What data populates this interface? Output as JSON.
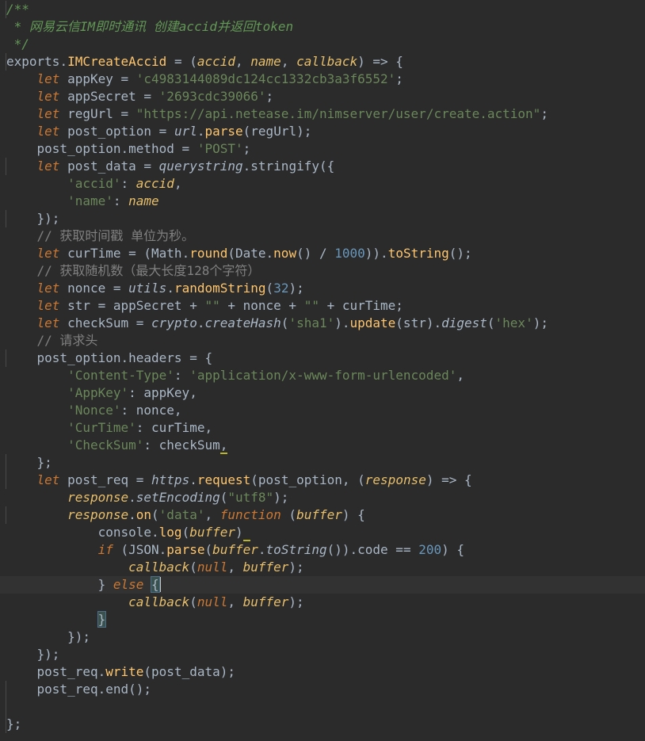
{
  "editor": {
    "colors": {
      "background": "#2b2b2b",
      "keyword": "#cc7832",
      "string": "#6a8759",
      "number": "#6897bb",
      "comment": "#629755",
      "function": "#ffc66d",
      "default": "#a9b7c6"
    },
    "current_line": 33,
    "lines": [
      [
        {
          "t": "/**",
          "c": "cm"
        }
      ],
      [
        {
          "t": " * 网易云信IM即时通讯 创建accid并返回token",
          "c": "cm"
        }
      ],
      [
        {
          "t": " */",
          "c": "cm"
        }
      ],
      [
        {
          "t": "exports",
          "c": "def"
        },
        {
          "t": ".",
          "c": "def"
        },
        {
          "t": "IMCreateAccid",
          "c": "exp"
        },
        {
          "t": " = (",
          "c": "def"
        },
        {
          "t": "accid",
          "c": "par"
        },
        {
          "t": ", ",
          "c": "def"
        },
        {
          "t": "name",
          "c": "par"
        },
        {
          "t": ", ",
          "c": "def"
        },
        {
          "t": "callback",
          "c": "par"
        },
        {
          "t": ") => {",
          "c": "def"
        }
      ],
      [
        {
          "t": "    ",
          "c": "def"
        },
        {
          "t": "let",
          "c": "kw"
        },
        {
          "t": " appKey = ",
          "c": "def"
        },
        {
          "t": "'c4983144089dc124cc1332cb3a3f6552'",
          "c": "str"
        },
        {
          "t": ";",
          "c": "def"
        }
      ],
      [
        {
          "t": "    ",
          "c": "def"
        },
        {
          "t": "let",
          "c": "kw"
        },
        {
          "t": " appSecret = ",
          "c": "def"
        },
        {
          "t": "'2693cdc39066'",
          "c": "str"
        },
        {
          "t": ";",
          "c": "def"
        }
      ],
      [
        {
          "t": "    ",
          "c": "def"
        },
        {
          "t": "let",
          "c": "kw"
        },
        {
          "t": " regUrl = ",
          "c": "def"
        },
        {
          "t": "\"https://api.netease.im/nimserver/user/create.action\"",
          "c": "str"
        },
        {
          "t": ";",
          "c": "def"
        }
      ],
      [
        {
          "t": "    ",
          "c": "def"
        },
        {
          "t": "let",
          "c": "kw"
        },
        {
          "t": " post_option = ",
          "c": "def"
        },
        {
          "t": "url",
          "c": "it"
        },
        {
          "t": ".",
          "c": "def"
        },
        {
          "t": "parse",
          "c": "fn"
        },
        {
          "t": "(regUrl);",
          "c": "def"
        }
      ],
      [
        {
          "t": "    post_option.method = ",
          "c": "def"
        },
        {
          "t": "'POST'",
          "c": "str"
        },
        {
          "t": ";",
          "c": "def"
        }
      ],
      [
        {
          "t": "    ",
          "c": "def"
        },
        {
          "t": "let",
          "c": "kw"
        },
        {
          "t": " post_data = ",
          "c": "def"
        },
        {
          "t": "querystring",
          "c": "it"
        },
        {
          "t": ".stringify({",
          "c": "def"
        }
      ],
      [
        {
          "t": "        ",
          "c": "def"
        },
        {
          "t": "'accid'",
          "c": "str"
        },
        {
          "t": ": ",
          "c": "def"
        },
        {
          "t": "accid",
          "c": "par"
        },
        {
          "t": ",",
          "c": "def"
        }
      ],
      [
        {
          "t": "        ",
          "c": "def"
        },
        {
          "t": "'name'",
          "c": "str"
        },
        {
          "t": ": ",
          "c": "def"
        },
        {
          "t": "name",
          "c": "par"
        }
      ],
      [
        {
          "t": "    });",
          "c": "def"
        }
      ],
      [
        {
          "t": "    // 获取时间戳 单位为秒。",
          "c": "cl"
        }
      ],
      [
        {
          "t": "    ",
          "c": "def"
        },
        {
          "t": "let",
          "c": "kw"
        },
        {
          "t": " curTime = (Math.",
          "c": "def"
        },
        {
          "t": "round",
          "c": "fn"
        },
        {
          "t": "(Date.",
          "c": "def"
        },
        {
          "t": "now",
          "c": "fn"
        },
        {
          "t": "() / ",
          "c": "def"
        },
        {
          "t": "1000",
          "c": "num"
        },
        {
          "t": ")).",
          "c": "def"
        },
        {
          "t": "toString",
          "c": "fn"
        },
        {
          "t": "();",
          "c": "def"
        }
      ],
      [
        {
          "t": "    // 获取随机数（最大长度128个字符）",
          "c": "cl"
        }
      ],
      [
        {
          "t": "    ",
          "c": "def"
        },
        {
          "t": "let",
          "c": "kw"
        },
        {
          "t": " nonce = ",
          "c": "def"
        },
        {
          "t": "utils",
          "c": "it"
        },
        {
          "t": ".",
          "c": "def"
        },
        {
          "t": "randomString",
          "c": "fn"
        },
        {
          "t": "(",
          "c": "def"
        },
        {
          "t": "32",
          "c": "num"
        },
        {
          "t": ");",
          "c": "def"
        }
      ],
      [
        {
          "t": "    ",
          "c": "def"
        },
        {
          "t": "let",
          "c": "kw"
        },
        {
          "t": " str = appSecret + ",
          "c": "def"
        },
        {
          "t": "\"\"",
          "c": "str"
        },
        {
          "t": " + nonce + ",
          "c": "def"
        },
        {
          "t": "\"\"",
          "c": "str"
        },
        {
          "t": " + curTime;",
          "c": "def"
        }
      ],
      [
        {
          "t": "    ",
          "c": "def"
        },
        {
          "t": "let",
          "c": "kw"
        },
        {
          "t": " checkSum = ",
          "c": "def"
        },
        {
          "t": "crypto",
          "c": "it"
        },
        {
          "t": ".",
          "c": "def"
        },
        {
          "t": "createHash",
          "c": "it"
        },
        {
          "t": "(",
          "c": "def"
        },
        {
          "t": "'sha1'",
          "c": "str"
        },
        {
          "t": ").",
          "c": "def"
        },
        {
          "t": "update",
          "c": "fn"
        },
        {
          "t": "(str).",
          "c": "def"
        },
        {
          "t": "digest",
          "c": "it"
        },
        {
          "t": "(",
          "c": "def"
        },
        {
          "t": "'hex'",
          "c": "str"
        },
        {
          "t": ");",
          "c": "def"
        }
      ],
      [
        {
          "t": "    // 请求头",
          "c": "cl"
        }
      ],
      [
        {
          "t": "    post_option.headers = {",
          "c": "def"
        }
      ],
      [
        {
          "t": "        ",
          "c": "def"
        },
        {
          "t": "'Content-Type'",
          "c": "str"
        },
        {
          "t": ": ",
          "c": "def"
        },
        {
          "t": "'application/x-www-form-urlencoded'",
          "c": "str"
        },
        {
          "t": ",",
          "c": "def"
        }
      ],
      [
        {
          "t": "        ",
          "c": "def"
        },
        {
          "t": "'AppKey'",
          "c": "str"
        },
        {
          "t": ": appKey,",
          "c": "def"
        }
      ],
      [
        {
          "t": "        ",
          "c": "def"
        },
        {
          "t": "'Nonce'",
          "c": "str"
        },
        {
          "t": ": nonce,",
          "c": "def"
        }
      ],
      [
        {
          "t": "        ",
          "c": "def"
        },
        {
          "t": "'CurTime'",
          "c": "str"
        },
        {
          "t": ": curTime,",
          "c": "def"
        }
      ],
      [
        {
          "t": "        ",
          "c": "def"
        },
        {
          "t": "'CheckSum'",
          "c": "str"
        },
        {
          "t": ": checkSum",
          "c": "def"
        },
        {
          "t": ",",
          "c": "warn"
        }
      ],
      [
        {
          "t": "    };",
          "c": "def"
        }
      ],
      [
        {
          "t": "    ",
          "c": "def"
        },
        {
          "t": "let",
          "c": "kw"
        },
        {
          "t": " post_req = ",
          "c": "def"
        },
        {
          "t": "https",
          "c": "it"
        },
        {
          "t": ".",
          "c": "def"
        },
        {
          "t": "request",
          "c": "fn"
        },
        {
          "t": "(post_option, (",
          "c": "def"
        },
        {
          "t": "response",
          "c": "par"
        },
        {
          "t": ") => {",
          "c": "def"
        }
      ],
      [
        {
          "t": "        ",
          "c": "def"
        },
        {
          "t": "response",
          "c": "par"
        },
        {
          "t": ".",
          "c": "def"
        },
        {
          "t": "setEncoding",
          "c": "it"
        },
        {
          "t": "(",
          "c": "def"
        },
        {
          "t": "\"utf8\"",
          "c": "str"
        },
        {
          "t": ");",
          "c": "def"
        }
      ],
      [
        {
          "t": "        ",
          "c": "def"
        },
        {
          "t": "response",
          "c": "par"
        },
        {
          "t": ".",
          "c": "def"
        },
        {
          "t": "on",
          "c": "fn"
        },
        {
          "t": "(",
          "c": "def"
        },
        {
          "t": "'data'",
          "c": "str"
        },
        {
          "t": ", ",
          "c": "def"
        },
        {
          "t": "function",
          "c": "kw"
        },
        {
          "t": " (",
          "c": "def"
        },
        {
          "t": "buffer",
          "c": "par"
        },
        {
          "t": ") {",
          "c": "def"
        }
      ],
      [
        {
          "t": "            console.",
          "c": "def"
        },
        {
          "t": "log",
          "c": "fn"
        },
        {
          "t": "(",
          "c": "def"
        },
        {
          "t": "buffer",
          "c": "par"
        },
        {
          "t": ")",
          "c": "def"
        },
        {
          "t": " ",
          "c": "warn"
        }
      ],
      [
        {
          "t": "            ",
          "c": "def"
        },
        {
          "t": "if",
          "c": "kw"
        },
        {
          "t": " (JSON.",
          "c": "def"
        },
        {
          "t": "parse",
          "c": "fn"
        },
        {
          "t": "(",
          "c": "def"
        },
        {
          "t": "buffer",
          "c": "par"
        },
        {
          "t": ".",
          "c": "def"
        },
        {
          "t": "toString",
          "c": "it"
        },
        {
          "t": "()).code == ",
          "c": "def"
        },
        {
          "t": "200",
          "c": "num"
        },
        {
          "t": ") {",
          "c": "def"
        }
      ],
      [
        {
          "t": "                ",
          "c": "def"
        },
        {
          "t": "callback",
          "c": "par"
        },
        {
          "t": "(",
          "c": "def"
        },
        {
          "t": "null",
          "c": "cn"
        },
        {
          "t": ", ",
          "c": "def"
        },
        {
          "t": "buffer",
          "c": "par"
        },
        {
          "t": ");",
          "c": "def"
        }
      ],
      [
        {
          "t": "            } ",
          "c": "def"
        },
        {
          "t": "else",
          "c": "kw"
        },
        {
          "t": " ",
          "c": "def"
        },
        {
          "t": "{",
          "c": "bh"
        },
        {
          "t": "",
          "c": "caret"
        }
      ],
      [
        {
          "t": "                ",
          "c": "def"
        },
        {
          "t": "callback",
          "c": "par"
        },
        {
          "t": "(",
          "c": "def"
        },
        {
          "t": "null",
          "c": "cn"
        },
        {
          "t": ", ",
          "c": "def"
        },
        {
          "t": "buffer",
          "c": "par"
        },
        {
          "t": ");",
          "c": "def"
        }
      ],
      [
        {
          "t": "            ",
          "c": "def"
        },
        {
          "t": "}",
          "c": "bh"
        }
      ],
      [
        {
          "t": "        });",
          "c": "def"
        }
      ],
      [
        {
          "t": "    });",
          "c": "def"
        }
      ],
      [
        {
          "t": "    post_req.",
          "c": "def"
        },
        {
          "t": "write",
          "c": "fn"
        },
        {
          "t": "(post_data);",
          "c": "def"
        }
      ],
      [
        {
          "t": "    post_req.end();",
          "c": "def"
        }
      ],
      [],
      [
        {
          "t": "};",
          "c": "def"
        }
      ]
    ]
  }
}
